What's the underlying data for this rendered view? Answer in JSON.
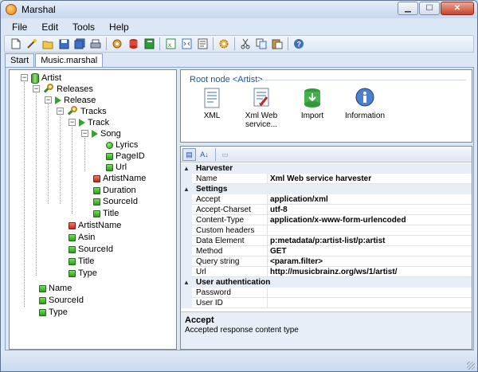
{
  "window": {
    "title": "Marshal",
    "minimize": "▁",
    "maximize": "☐",
    "close": "✕"
  },
  "menu": [
    {
      "label": "File"
    },
    {
      "label": "Edit"
    },
    {
      "label": "Tools"
    },
    {
      "label": "Help"
    }
  ],
  "toolbar_icons": [
    "new-document-icon",
    "wand-icon",
    "open-folder-icon",
    "save-icon",
    "save-all-icon",
    "print-icon",
    "settings-cog-icon",
    "database-icon",
    "book-icon",
    "excel-export-icon",
    "xml-export-icon",
    "text-export-icon",
    "gear-icon",
    "cut-icon",
    "copy-icon",
    "paste-icon",
    "help-icon"
  ],
  "tabs": [
    {
      "label": "Start"
    },
    {
      "label": "Music.marshal"
    }
  ],
  "tree": [
    {
      "label": "Artist",
      "icon": "database-icon"
    },
    {
      "label": "Releases",
      "icon": "search-icon"
    },
    {
      "label": "Release",
      "icon": "play-icon"
    },
    {
      "label": "Tracks",
      "icon": "search-icon"
    },
    {
      "label": "Track",
      "icon": "play-icon"
    },
    {
      "label": "Song",
      "icon": "play-icon"
    },
    {
      "label": "Lyrics",
      "icon": "circle-icon"
    },
    {
      "label": "PageID",
      "icon": "field-icon"
    },
    {
      "label": "Url",
      "icon": "field-icon"
    },
    {
      "label": "ArtistName",
      "icon": "key-field-icon"
    },
    {
      "label": "Duration",
      "icon": "field-icon"
    },
    {
      "label": "SourceId",
      "icon": "field-icon"
    },
    {
      "label": "Title",
      "icon": "field-icon"
    },
    {
      "label": "ArtistName",
      "icon": "key-field-icon"
    },
    {
      "label": "Asin",
      "icon": "field-icon"
    },
    {
      "label": "SourceId",
      "icon": "field-icon"
    },
    {
      "label": "Title",
      "icon": "field-icon"
    },
    {
      "label": "Type",
      "icon": "field-icon"
    },
    {
      "label": "Name",
      "icon": "field-icon"
    },
    {
      "label": "SourceId",
      "icon": "field-icon"
    },
    {
      "label": "Type",
      "icon": "field-icon"
    }
  ],
  "root_panel": {
    "title": "Root node <Artist>",
    "harvesters": [
      {
        "label": "XML",
        "icon": "xml-file-icon"
      },
      {
        "label": "Xml Web service...",
        "icon": "web-service-icon"
      },
      {
        "label": "Import",
        "icon": "import-icon"
      },
      {
        "label": "Information",
        "icon": "info-icon"
      }
    ]
  },
  "props_toolbar": {
    "categorized": "▤",
    "alphabetical": "A↓",
    "pages": "▭"
  },
  "properties": {
    "categories": [
      {
        "name": "Harvester",
        "rows": [
          {
            "name": "Name",
            "value": "Xml Web service harvester"
          }
        ]
      },
      {
        "name": "Settings",
        "rows": [
          {
            "name": "Accept",
            "value": "application/xml"
          },
          {
            "name": "Accept-Charset",
            "value": "utf-8"
          },
          {
            "name": "Content-Type",
            "value": "application/x-www-form-urlencoded"
          },
          {
            "name": "Custom headers",
            "value": ""
          },
          {
            "name": "Data Element",
            "value": "p:metadata/p:artist-list/p:artist"
          },
          {
            "name": "Method",
            "value": "GET"
          },
          {
            "name": "Query string",
            "value": "<param.filter>"
          },
          {
            "name": "Url",
            "value": "http://musicbrainz.org/ws/1/artist/"
          }
        ]
      },
      {
        "name": "User authentication",
        "rows": [
          {
            "name": "Password",
            "value": ""
          },
          {
            "name": "User ID",
            "value": ""
          }
        ]
      }
    ]
  },
  "description": {
    "title": "Accept",
    "text": "Accepted response content type"
  },
  "colors": {
    "chrome": "#dce7f5",
    "accent": "#1f4fa8",
    "field_green": "#2a9d1d",
    "key_red": "#c0281a"
  }
}
